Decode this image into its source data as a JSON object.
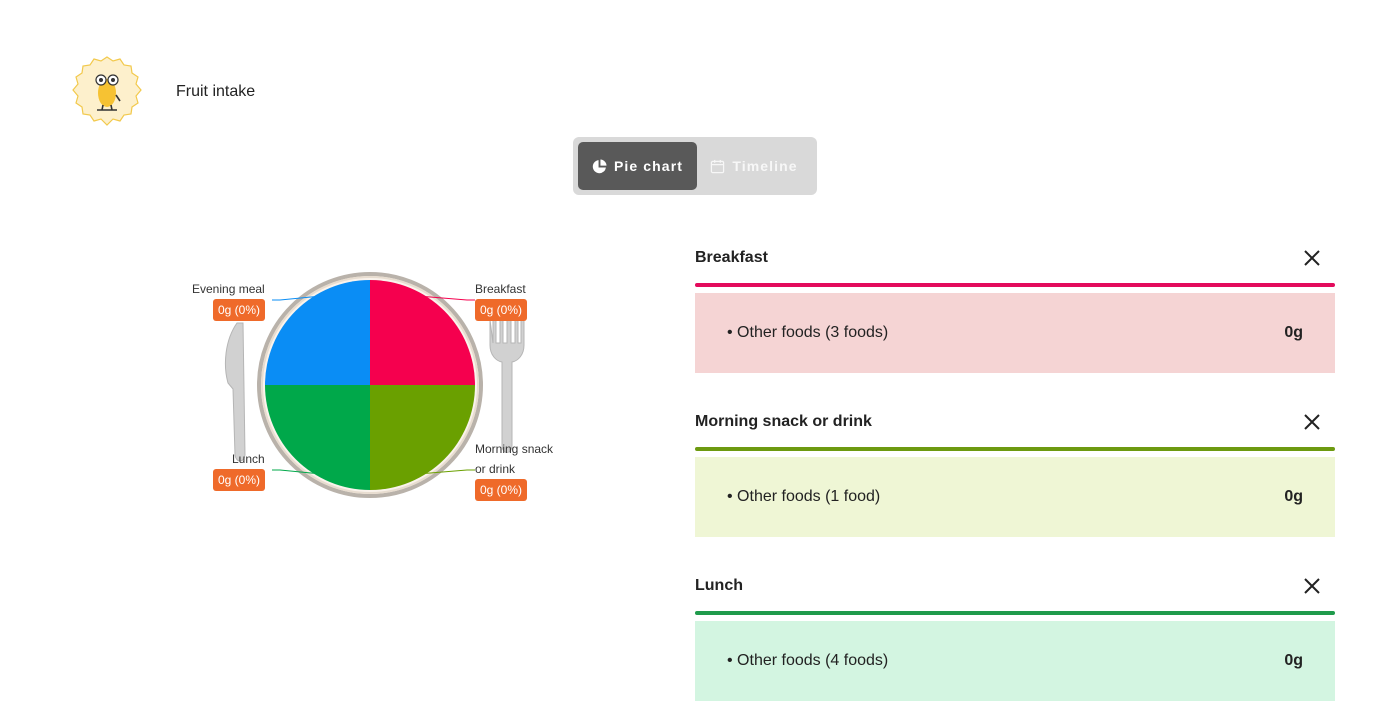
{
  "header": {
    "title": "Fruit intake",
    "badge_icon": "banana-mascot-icon"
  },
  "view_toggle": {
    "options": [
      {
        "label": "Pie chart",
        "icon": "pie-chart-icon",
        "active": true
      },
      {
        "label": "Timeline",
        "icon": "calendar-icon",
        "active": false
      }
    ]
  },
  "chart_data": {
    "type": "pie",
    "slices": [
      {
        "label": "Breakfast",
        "value": 0,
        "display": "0g (0%)",
        "color": "#f5004e"
      },
      {
        "label": "Morning snack or drink",
        "value": 0,
        "display": "0g (0%)",
        "color": "#6aa000"
      },
      {
        "label": "Lunch",
        "value": 0,
        "display": "0g (0%)",
        "color": "#00a84a"
      },
      {
        "label": "Evening meal",
        "value": 0,
        "display": "0g (0%)",
        "color": "#0a8df5"
      }
    ]
  },
  "pie_labels": {
    "breakfast": {
      "line1": "Breakfast"
    },
    "morning": {
      "line1": "Morning snack",
      "line2": "or drink"
    },
    "lunch": {
      "line1": "Lunch"
    },
    "evening": {
      "line1": "Evening meal"
    }
  },
  "meals": [
    {
      "name": "Breakfast",
      "color": "#e30b5c",
      "bg": "#f5d4d4",
      "item": "Other foods (3 foods)",
      "amount": "0g"
    },
    {
      "name": "Morning snack or drink",
      "color": "#6d9a10",
      "bg": "#eff6d5",
      "item": "Other foods (1 food)",
      "amount": "0g"
    },
    {
      "name": "Lunch",
      "color": "#1f9b4c",
      "bg": "#d3f5e1",
      "item": "Other foods (4 foods)",
      "amount": "0g"
    }
  ]
}
